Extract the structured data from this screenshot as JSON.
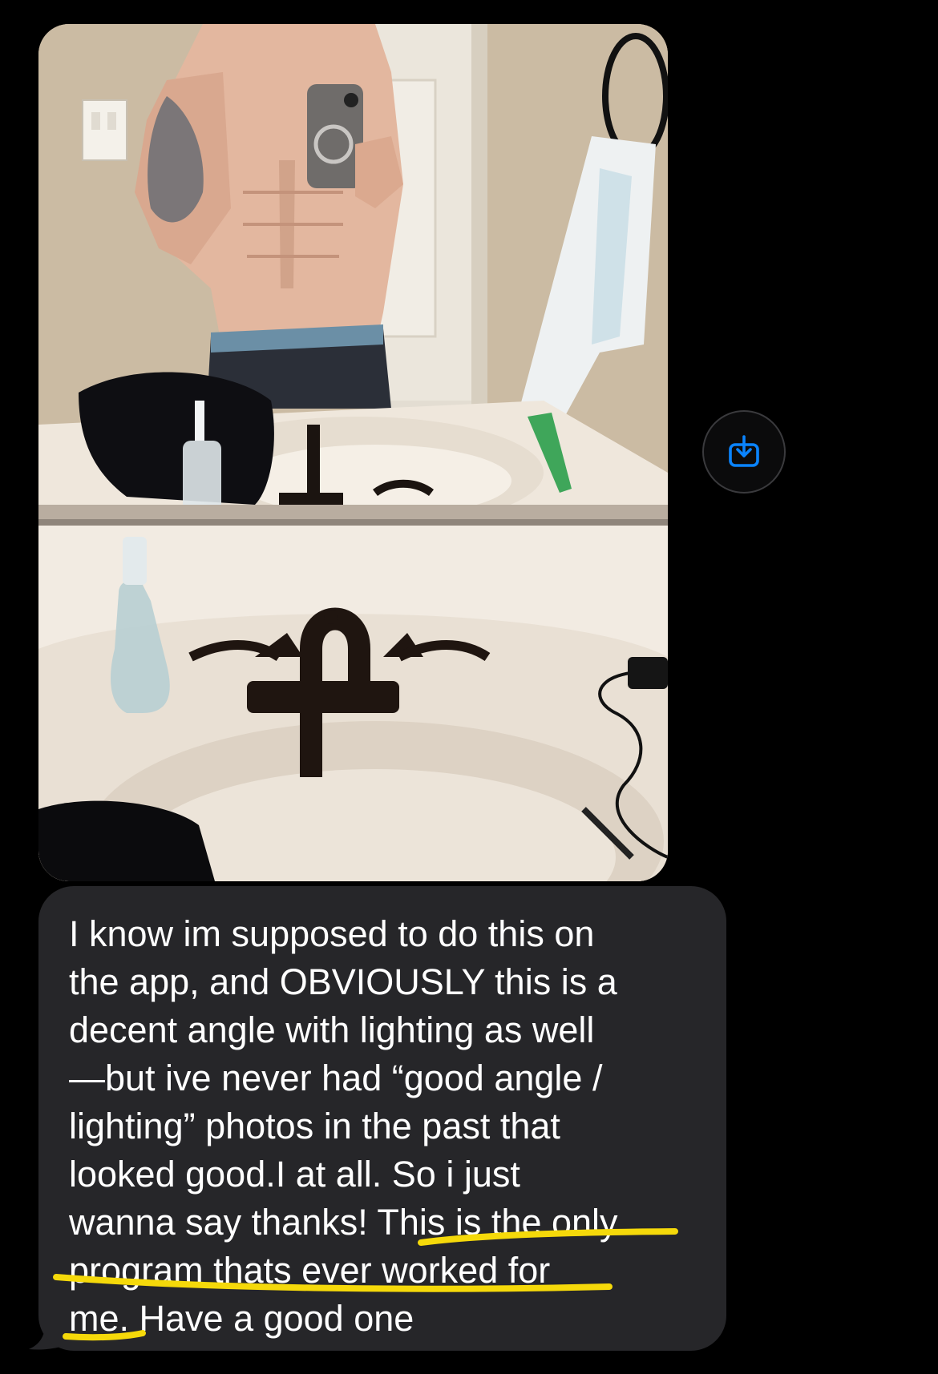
{
  "conversation": {
    "attachment": {
      "type": "photo",
      "save_button_icon": "download-icon"
    },
    "message": {
      "text": "I know im supposed to do this on the app, and OBVIOUSLY this is a decent angle with lighting as well —but ive never had “good angle / lighting” photos in the past that looked good.I at all. So i just wanna say thanks! This is the only program thats ever worked for me. Have a good one",
      "lines": [
        "I know im supposed to do this on",
        "the app, and OBVIOUSLY this is a",
        "decent angle with lighting as well",
        "—but ive never had “good angle /",
        "lighting” photos in the past that",
        "looked good.I at all. So i just",
        "wanna say thanks! This is the only",
        "program thats ever worked for",
        "me. Have a good one"
      ],
      "highlighted_phrase": "This is the only program thats ever worked for me."
    }
  },
  "colors": {
    "background": "#000000",
    "bubble": "#262629",
    "text": "#ffffff",
    "accent_blue": "#0a84ff",
    "highlight_yellow": "#f5d90a"
  }
}
